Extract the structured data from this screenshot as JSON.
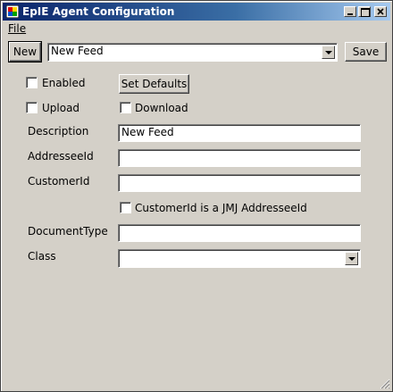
{
  "window": {
    "title": "EpIE Agent Configuration"
  },
  "menu": {
    "file": "File"
  },
  "toolbar": {
    "new_label": "New",
    "feed_value": "New Feed",
    "save_label": "Save"
  },
  "form": {
    "enabled_label": "Enabled",
    "set_defaults_label": "Set Defaults",
    "upload_label": "Upload",
    "download_label": "Download",
    "description_label": "Description",
    "description_value": "New Feed",
    "addresseeid_label": "AddresseeId",
    "addresseeid_value": "",
    "customerid_label": "CustomerId",
    "customerid_value": "",
    "customerid_jmj_label": "CustomerId is a JMJ AddresseeId",
    "documenttype_label": "DocumentType",
    "documenttype_value": "",
    "class_label": "Class",
    "class_value": ""
  },
  "colors": {
    "titlebar_start": "#0a246a",
    "titlebar_end": "#a6caf0",
    "face": "#d4d0c8"
  }
}
